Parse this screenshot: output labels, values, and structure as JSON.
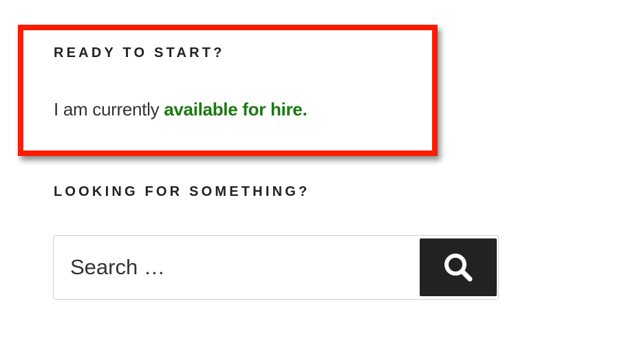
{
  "widgets": {
    "ready": {
      "title": "READY TO START?",
      "text_prefix": "I am currently ",
      "link_text": "available for hire."
    },
    "search": {
      "title": "LOOKING FOR SOMETHING?",
      "placeholder": "Search …",
      "button_icon": "search-icon"
    }
  },
  "colors": {
    "highlight_border": "#ff1a00",
    "link": "#1a7a10",
    "button_bg": "#222222",
    "text": "#222222"
  }
}
